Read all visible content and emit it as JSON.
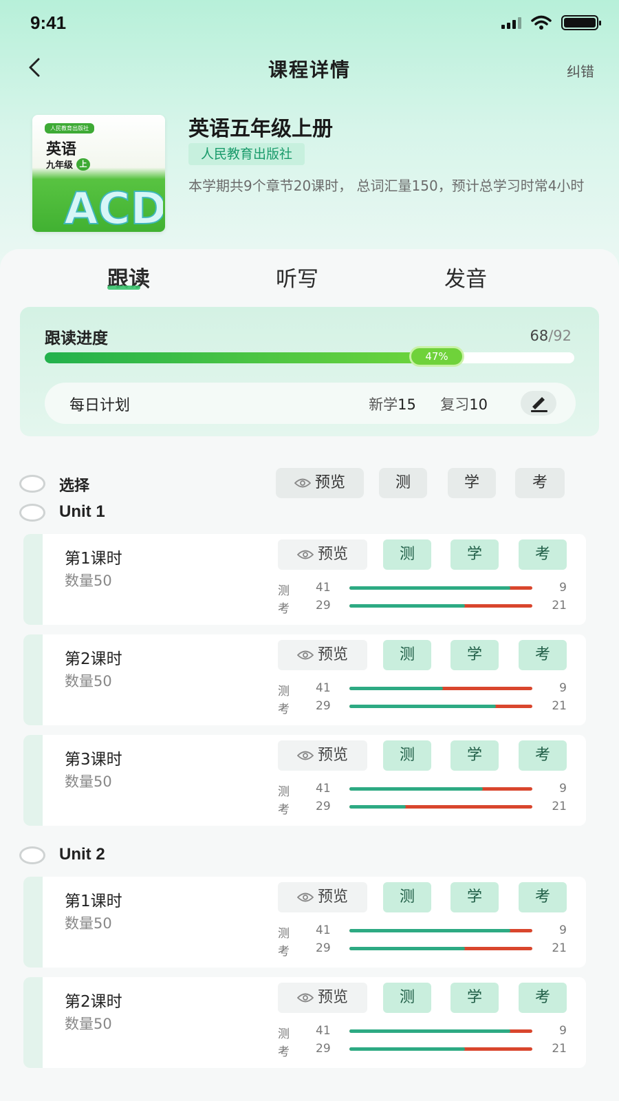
{
  "status": {
    "time": "9:41"
  },
  "nav": {
    "title": "课程详情",
    "right": "纠错"
  },
  "book": {
    "publisher": "人民教育出版社",
    "title": "英语",
    "grade": "九年级",
    "grade_badge": "上",
    "letters": "ACD"
  },
  "course": {
    "title": "英语五年级上册",
    "publisher": "人民教育出版社",
    "description": "本学期共9个章节20课时， 总词汇量150，预计总学习时常4小时"
  },
  "tabs": [
    {
      "label": "跟读",
      "active": true
    },
    {
      "label": "听写",
      "active": false
    },
    {
      "label": "发音",
      "active": false
    }
  ],
  "progress": {
    "label": "跟读进度",
    "current": "68",
    "separator": "/",
    "total": "92",
    "percent_label": "47%",
    "percent": 0.74
  },
  "plan": {
    "label": "每日计划",
    "new_label": "新学",
    "new_value": "15",
    "review_label": "复习",
    "review_value": "10"
  },
  "list_header": {
    "select_label": "选择",
    "preview": "预览",
    "test": "测",
    "learn": "学",
    "exam": "考"
  },
  "colors": {
    "accent": "#2daa83",
    "error": "#d9462d",
    "progress": "#22b14c"
  },
  "units": [
    {
      "name": "Unit 1",
      "lessons": [
        {
          "title": "第1课时",
          "count": "数量50",
          "test_label": "测",
          "test_left": "41",
          "test_right": "9",
          "test_ratio": 0.88,
          "exam_label": "考",
          "exam_left": "29",
          "exam_right": "21",
          "exam_ratio": 0.63
        },
        {
          "title": "第2课时",
          "count": "数量50",
          "test_label": "测",
          "test_left": "41",
          "test_right": "9",
          "test_ratio": 0.51,
          "exam_label": "考",
          "exam_left": "29",
          "exam_right": "21",
          "exam_ratio": 0.8
        },
        {
          "title": "第3课时",
          "count": "数量50",
          "test_label": "测",
          "test_left": "41",
          "test_right": "9",
          "test_ratio": 0.73,
          "exam_label": "考",
          "exam_left": "29",
          "exam_right": "21",
          "exam_ratio": 0.31
        }
      ]
    },
    {
      "name": "Unit 2",
      "lessons": [
        {
          "title": "第1课时",
          "count": "数量50",
          "test_label": "测",
          "test_left": "41",
          "test_right": "9",
          "test_ratio": 0.88,
          "exam_label": "考",
          "exam_left": "29",
          "exam_right": "21",
          "exam_ratio": 0.63
        },
        {
          "title": "第2课时",
          "count": "数量50",
          "test_label": "测",
          "test_left": "41",
          "test_right": "9",
          "test_ratio": 0.88,
          "exam_label": "考",
          "exam_left": "29",
          "exam_right": "21",
          "exam_ratio": 0.63
        }
      ]
    }
  ],
  "lesson_buttons": {
    "preview": "预览",
    "test": "测",
    "learn": "学",
    "exam": "考"
  }
}
